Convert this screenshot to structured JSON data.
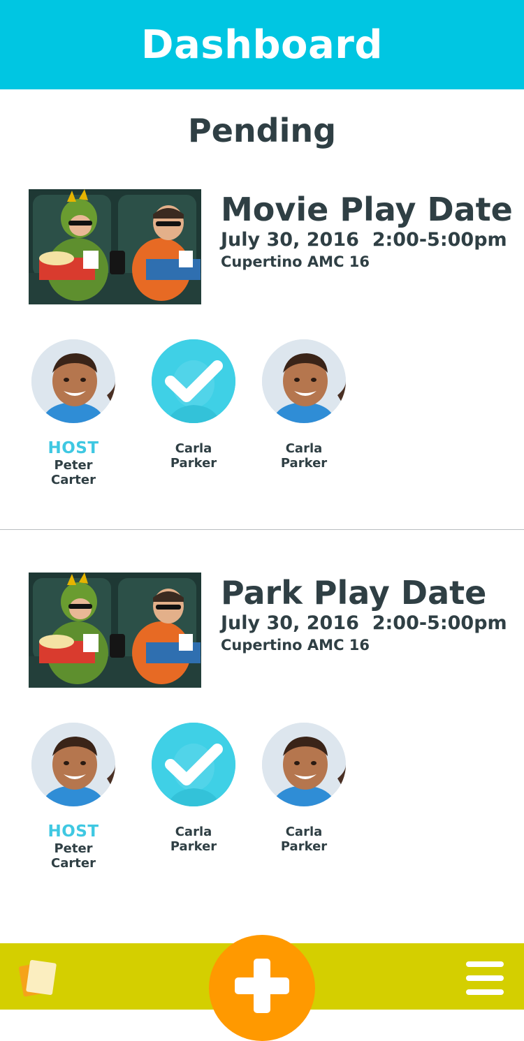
{
  "header": {
    "title": "Dashboard"
  },
  "section": {
    "title": "Pending"
  },
  "cards": [
    {
      "title": "Movie Play Date",
      "datetime": "July 30, 2016  2:00-5:00pm",
      "location": "Cupertino AMC 16",
      "attendees": [
        {
          "role": "HOST",
          "first": "Peter",
          "last": "Carter",
          "confirmed": false
        },
        {
          "role": "",
          "first": "Carla",
          "last": "Parker",
          "confirmed": true
        },
        {
          "role": "",
          "first": "Carla",
          "last": "Parker",
          "confirmed": false
        }
      ]
    },
    {
      "title": "Park Play Date",
      "datetime": "July 30, 2016  2:00-5:00pm",
      "location": "Cupertino AMC 16",
      "attendees": [
        {
          "role": "HOST",
          "first": "Peter",
          "last": "Carter",
          "confirmed": false
        },
        {
          "role": "",
          "first": "Carla",
          "last": "Parker",
          "confirmed": true
        },
        {
          "role": "",
          "first": "Carla",
          "last": "Parker",
          "confirmed": false
        }
      ]
    }
  ],
  "colors": {
    "header": "#00c6e2",
    "accent": "#3fc8e2",
    "text": "#2f3f44",
    "bottom_bar": "#d4cf00",
    "add_button": "#ff9900"
  },
  "icons": {
    "left": "cards-icon",
    "center": "plus-icon",
    "right": "menu-icon",
    "confirm": "checkmark-icon"
  }
}
